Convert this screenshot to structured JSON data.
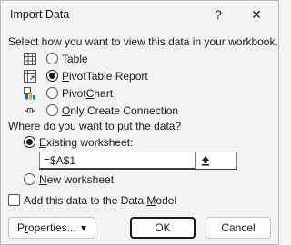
{
  "window": {
    "title": "Import Data",
    "help_glyph": "?",
    "close_glyph": "✕"
  },
  "view_section": {
    "label": "Select how you want to view this data in your workbook.",
    "options": [
      {
        "pre": "",
        "key": "T",
        "post": "able",
        "icon": "table-icon",
        "checked": false
      },
      {
        "pre": "",
        "key": "P",
        "post": "ivotTable Report",
        "icon": "pivottable-icon",
        "checked": true
      },
      {
        "pre": "Pivot",
        "key": "C",
        "post": "hart",
        "icon": "pivotchart-icon",
        "checked": false
      },
      {
        "pre": "",
        "key": "O",
        "post": "nly Create Connection",
        "icon": "connection-icon",
        "checked": false
      }
    ]
  },
  "location_section": {
    "label": "Where do you want to put the data?",
    "existing": {
      "pre": "",
      "key": "E",
      "post": "xisting worksheet:",
      "checked": true
    },
    "range_value": "=$A$1",
    "new": {
      "pre": "",
      "key": "N",
      "post": "ew worksheet",
      "checked": false
    }
  },
  "data_model": {
    "pre": "Add this data to the Data ",
    "key": "M",
    "post": "odel",
    "checked": false
  },
  "buttons": {
    "properties": {
      "pre": "P",
      "key": "r",
      "post": "operties..."
    },
    "properties_arrow": "▾",
    "ok": "OK",
    "cancel": "Cancel"
  },
  "colors": {
    "accent": "#0f6cbd",
    "dialog_bg": "#f3f3f3",
    "text": "#1a1a1a"
  }
}
